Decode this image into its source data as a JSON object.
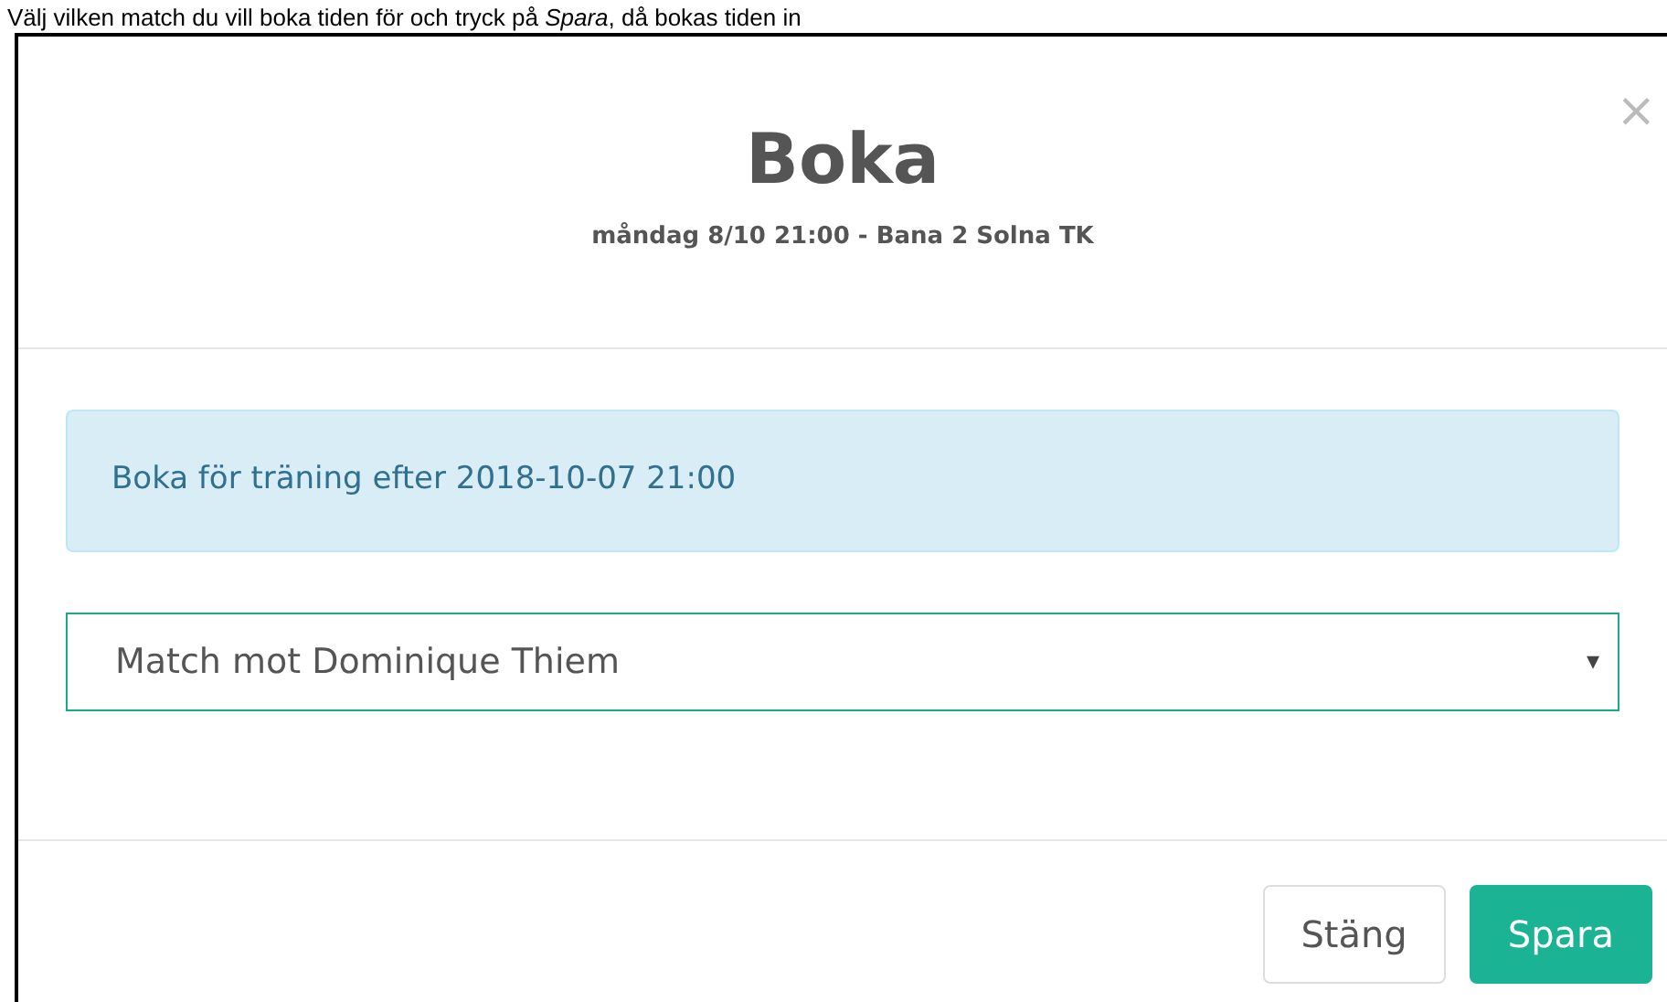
{
  "instruction": "Välj vilken match du vill boka tiden för och tryck på *Spara*, då bokas tiden in",
  "modal": {
    "title": "Boka",
    "subtitle": "måndag 8/10 21:00 - Bana 2 Solna TK",
    "close": "×",
    "alert": "Boka för träning efter 2018-10-07 21:00",
    "select": {
      "value": "Match mot Dominique Thiem",
      "caret": "▾"
    },
    "buttons": [
      {
        "label": "Stäng",
        "kind": "default"
      },
      {
        "label": "Spara",
        "kind": "primary"
      }
    ]
  }
}
